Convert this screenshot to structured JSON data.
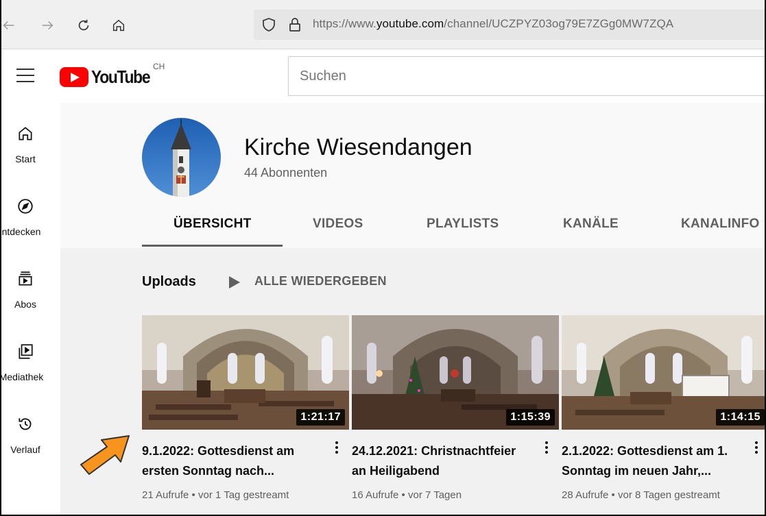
{
  "browser": {
    "url_prefix": "https://www.",
    "url_domain": "youtube.com",
    "url_path": "/channel/UCZPYZ03og79E7ZGg0MW7ZQA"
  },
  "header": {
    "logo_text": "YouTube",
    "country_code": "CH",
    "search_placeholder": "Suchen"
  },
  "sidebar": {
    "items": [
      {
        "label": "Start",
        "icon": "home-icon"
      },
      {
        "label": "ntdecken",
        "icon": "compass-icon"
      },
      {
        "label": "Abos",
        "icon": "subscriptions-icon"
      },
      {
        "label": "Mediathek",
        "icon": "library-icon"
      },
      {
        "label": "Verlauf",
        "icon": "history-icon"
      }
    ]
  },
  "channel": {
    "name": "Kirche Wiesendangen",
    "subscribers": "44 Abonnenten",
    "tabs": [
      "ÜBERSICHT",
      "VIDEOS",
      "PLAYLISTS",
      "KANÄLE",
      "KANALINFO"
    ],
    "active_tab": "ÜBERSICHT"
  },
  "uploads": {
    "title": "Uploads",
    "play_all": "ALLE WIEDERGEBEN",
    "videos": [
      {
        "duration": "1:21:17",
        "title": "9.1.2022: Gottesdienst am ersten Sonntag nach...",
        "meta": "21 Aufrufe • vor 1 Tag gestreamt"
      },
      {
        "duration": "1:15:39",
        "title": "24.12.2021: Christnachtfeier an Heiligabend",
        "meta": "16 Aufrufe • vor 7 Tagen"
      },
      {
        "duration": "1:14:15",
        "title": "2.1.2022: Gottesdienst am 1. Sonntag im neuen Jahr,...",
        "meta": "28 Aufrufe • vor 8 Tagen gestreamt"
      }
    ]
  },
  "colors": {
    "brand_red": "#ff0000",
    "annotation_arrow": "#f7941d"
  }
}
